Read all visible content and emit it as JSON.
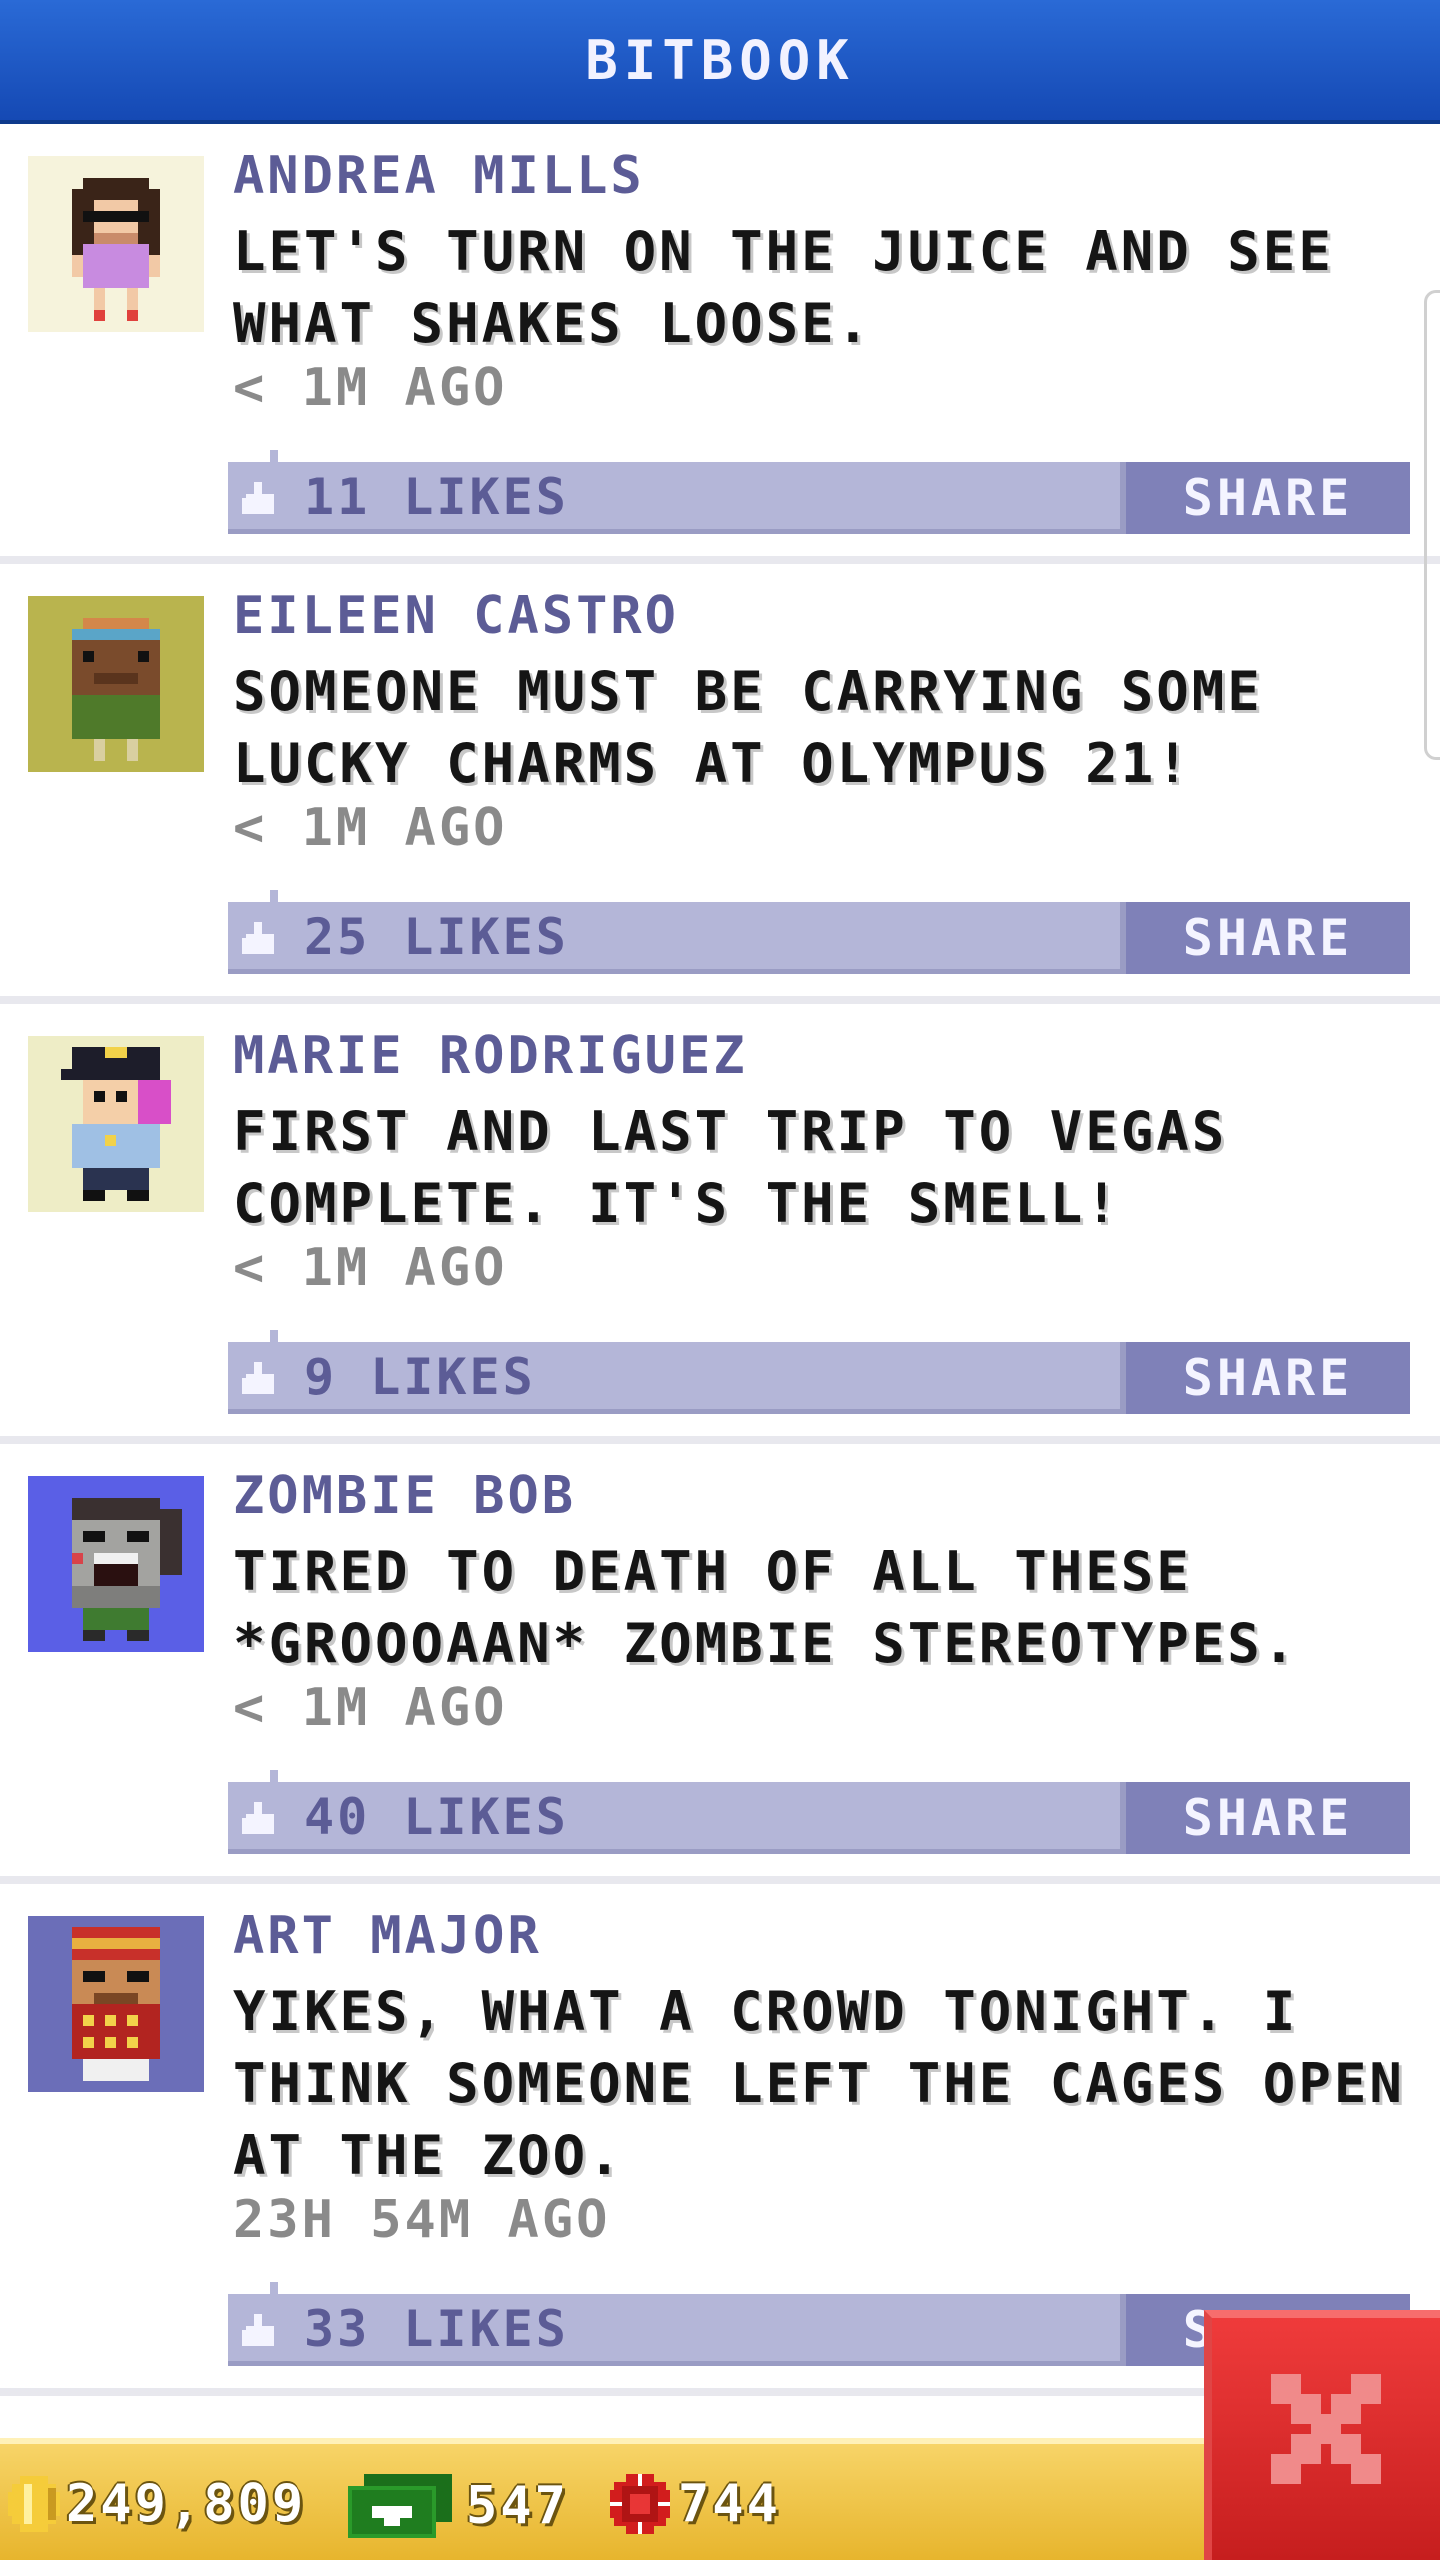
{
  "header": {
    "title": "BITBOOK"
  },
  "posts": [
    {
      "author": "ANDREA MILLS",
      "message": "LET'S TURN ON THE JUICE AND SEE WHAT SHAKES LOOSE.",
      "time": "< 1M AGO",
      "likes": "11 LIKES",
      "share_label": "SHARE",
      "avatar_icon": "woman-sunglasses-avatar-icon",
      "avatar_bg": "#f6f3dc"
    },
    {
      "author": "EILEEN CASTRO",
      "message": "SOMEONE MUST BE CARRYING SOME LUCKY CHARMS AT OLYMPUS 21!",
      "time": "< 1M AGO",
      "likes": "25 LIKES",
      "share_label": "SHARE",
      "avatar_icon": "woman-headband-avatar-icon",
      "avatar_bg": "#b9b44e"
    },
    {
      "author": "MARIE RODRIGUEZ",
      "message": "FIRST AND LAST TRIP TO VEGAS COMPLETE. IT'S THE SMELL!",
      "time": "< 1M AGO",
      "likes": "9 LIKES",
      "share_label": "SHARE",
      "avatar_icon": "police-officer-avatar-icon",
      "avatar_bg": "#eeedc6"
    },
    {
      "author": "ZOMBIE BOB",
      "message": "TIRED TO DEATH OF ALL THESE *GROOOAAN* ZOMBIE STEREOTYPES.",
      "time": "< 1M AGO",
      "likes": "40 LIKES",
      "share_label": "SHARE",
      "avatar_icon": "zombie-avatar-icon",
      "avatar_bg": "#5a5fe6"
    },
    {
      "author": "ART MAJOR",
      "message": "YIKES, WHAT A CROWD TONIGHT. I THINK SOMEONE LEFT THE CAGES OPEN AT THE ZOO.",
      "time": "23H 54M AGO",
      "likes": "33 LIKES",
      "share_label": "SHARE",
      "avatar_icon": "bellhop-avatar-icon",
      "avatar_bg": "#6b6eb8"
    }
  ],
  "footer": {
    "coins": "249,809",
    "bux": "547",
    "chips": "744"
  },
  "colors": {
    "header_blue": "#1c57c4",
    "name_purple": "#5c5c96",
    "like_bar": "#b4b6d8",
    "share_button": "#7f81b8",
    "footer_gold": "#e9b932",
    "close_red": "#d92828"
  }
}
